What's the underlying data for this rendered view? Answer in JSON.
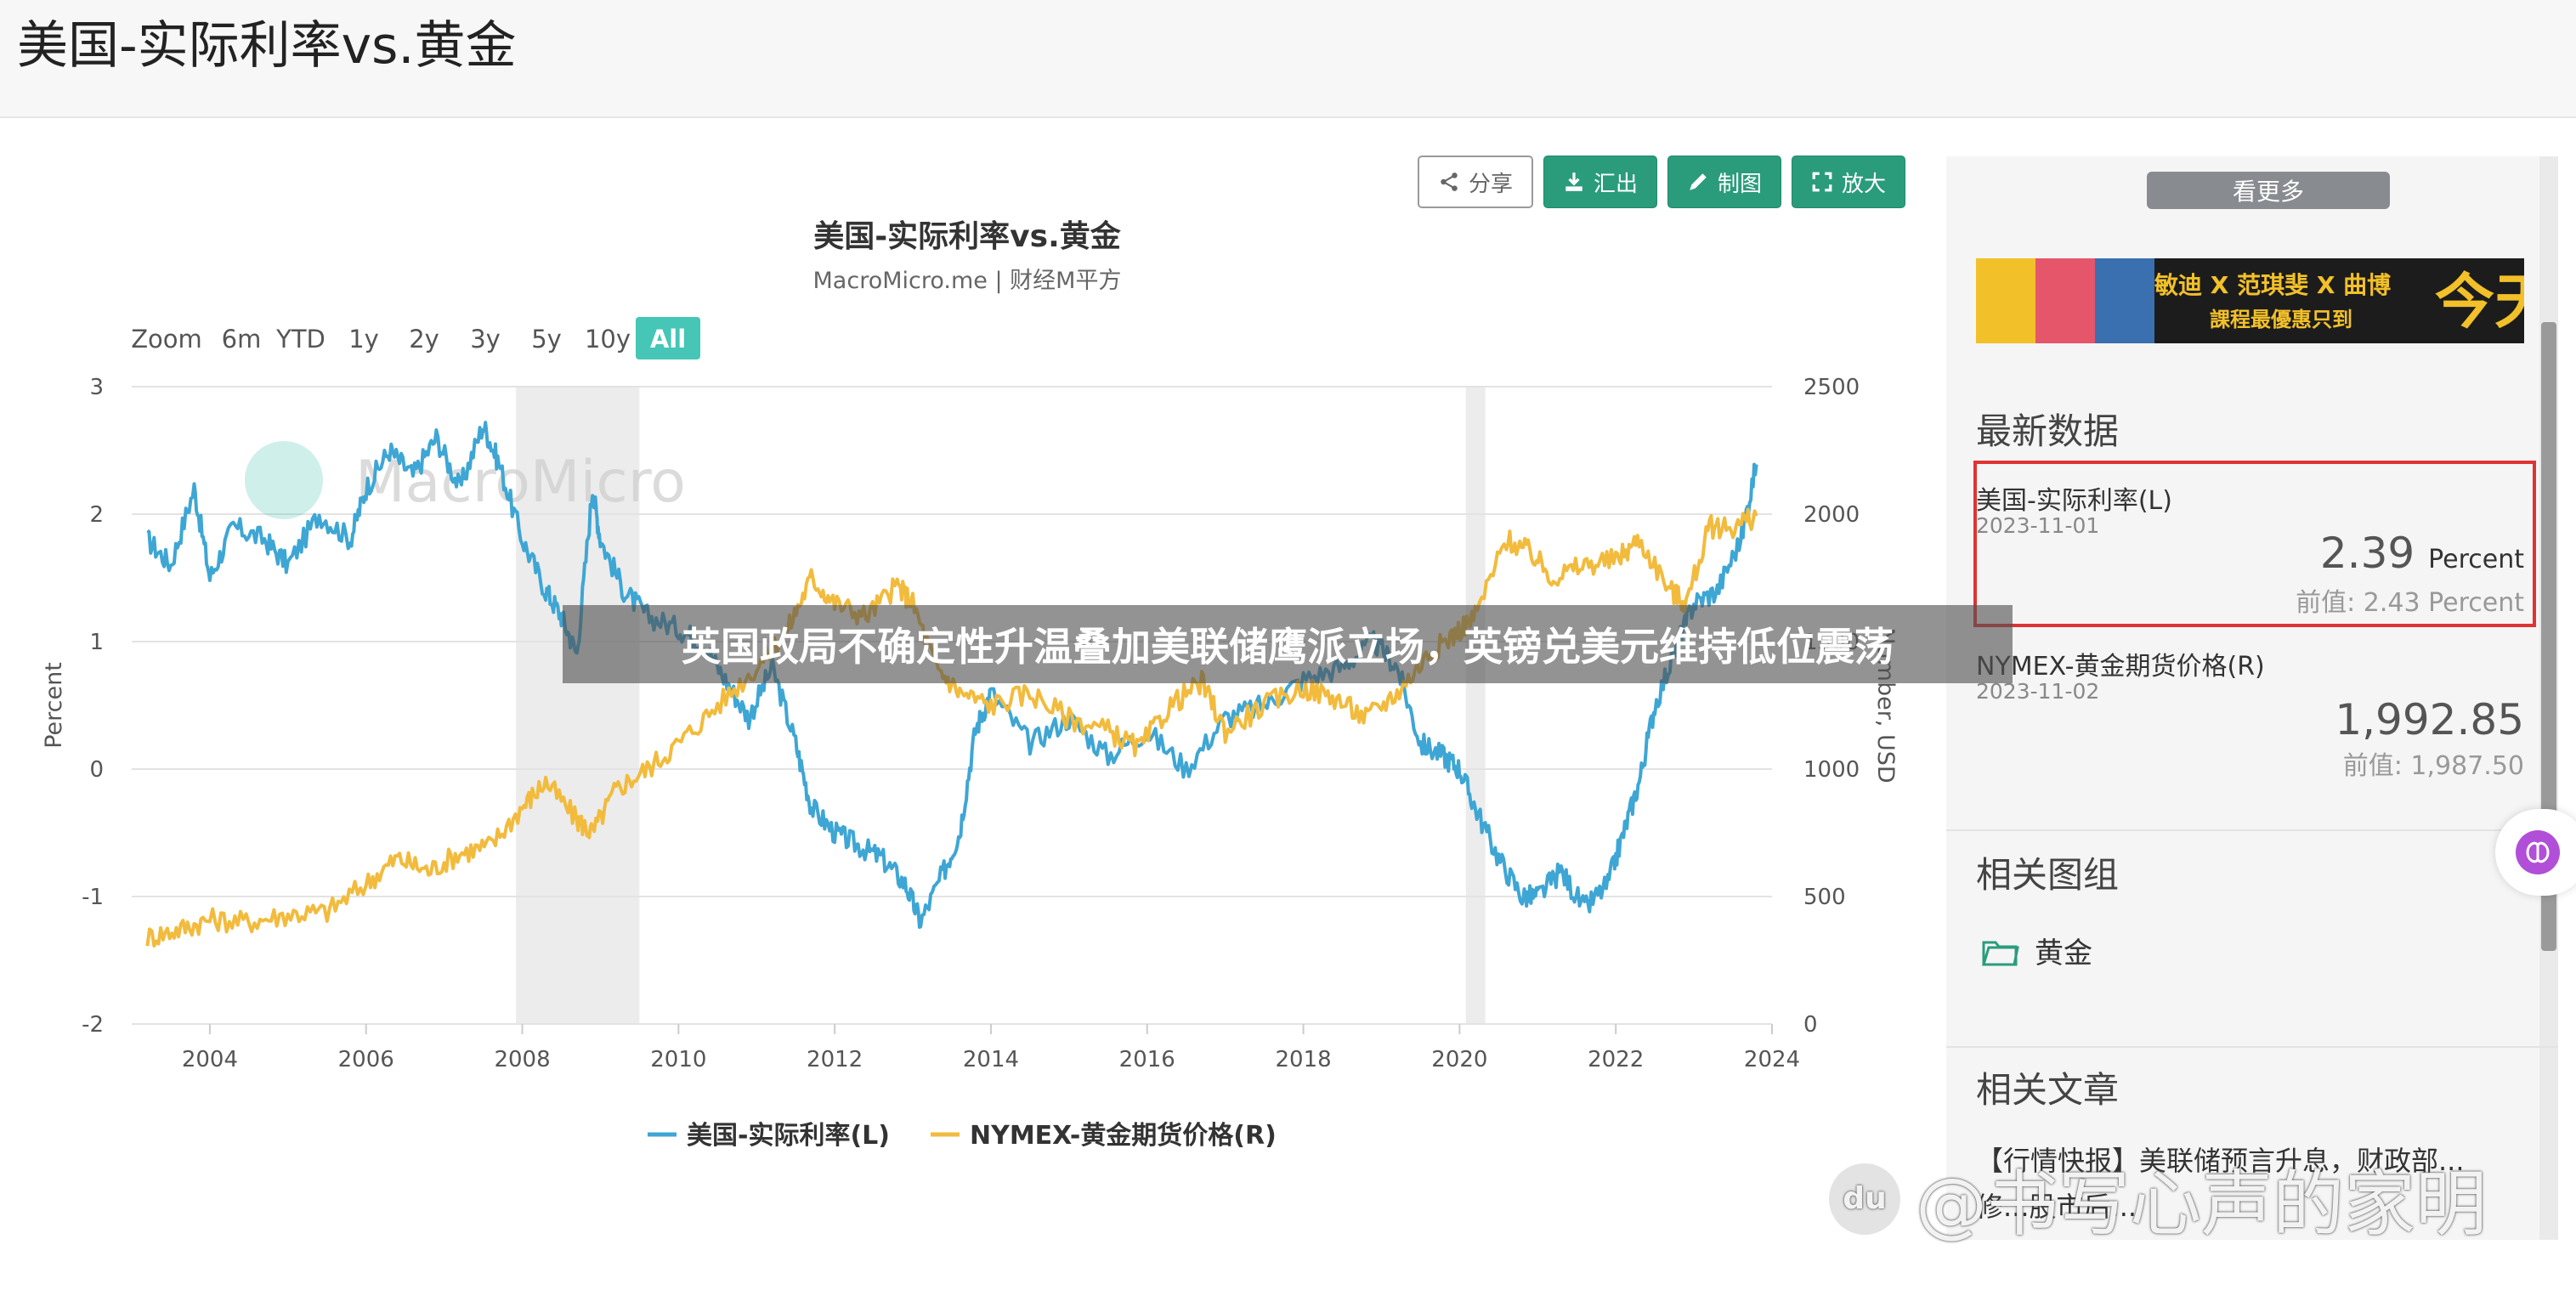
{
  "page": {
    "title": "美国-实际利率vs.黄金"
  },
  "toolbar": {
    "share": "分享",
    "export": "汇出",
    "draw": "制图",
    "zoom": "放大"
  },
  "chart_data": {
    "type": "line",
    "title": "美国-实际利率vs.黄金",
    "subtitle": "MacroMicro.me | 财经M平方",
    "watermark": "MacroMicro",
    "range_buttons": [
      "Zoom",
      "6m",
      "YTD",
      "1y",
      "2y",
      "3y",
      "5y",
      "10y",
      "All"
    ],
    "selected_range": "All",
    "xlim": [
      2003.0,
      2024.0
    ],
    "x_ticks": [
      "2004",
      "2006",
      "2008",
      "2010",
      "2012",
      "2014",
      "2016",
      "2018",
      "2020",
      "2022",
      "2024"
    ],
    "y_left": {
      "label": "Percent",
      "lim": [
        -2,
        3
      ],
      "ticks": [
        "3",
        "2",
        "1",
        "0",
        "-1",
        "-2"
      ]
    },
    "y_right": {
      "label": "Number, USD",
      "lim": [
        0,
        2500
      ],
      "ticks": [
        "2500",
        "2000",
        "1500",
        "1000",
        "500",
        "0"
      ]
    },
    "recession_bands": [
      [
        2007.92,
        2009.5
      ],
      [
        2020.08,
        2020.33
      ]
    ],
    "grid": true,
    "legend_position": "bottom",
    "colors": {
      "real_rate": "#3ea6d4",
      "gold": "#f2bb3d",
      "recession": "#ececec"
    },
    "series": [
      {
        "name": "美国-实际利率(L)",
        "axis": "left",
        "x": [
          2003.2,
          2003.5,
          2003.8,
          2004.0,
          2004.3,
          2004.7,
          2005.0,
          2005.4,
          2005.8,
          2006.0,
          2006.3,
          2006.6,
          2006.9,
          2007.2,
          2007.5,
          2007.7,
          2008.0,
          2008.3,
          2008.5,
          2008.7,
          2008.9,
          2009.0,
          2009.3,
          2009.6,
          2010.0,
          2010.3,
          2010.6,
          2010.9,
          2011.2,
          2011.5,
          2011.7,
          2012.0,
          2012.3,
          2012.6,
          2012.9,
          2013.1,
          2013.4,
          2013.6,
          2013.8,
          2014.0,
          2014.5,
          2015.0,
          2015.5,
          2016.0,
          2016.5,
          2017.0,
          2017.5,
          2018.0,
          2018.5,
          2018.9,
          2019.2,
          2019.5,
          2019.8,
          2020.0,
          2020.2,
          2020.5,
          2020.8,
          2021.0,
          2021.3,
          2021.6,
          2021.9,
          2022.1,
          2022.3,
          2022.5,
          2022.8,
          2023.0,
          2023.3,
          2023.6,
          2023.8
        ],
        "y": [
          1.8,
          1.6,
          2.2,
          1.5,
          1.9,
          1.8,
          1.6,
          2.0,
          1.8,
          2.2,
          2.5,
          2.3,
          2.6,
          2.2,
          2.7,
          2.4,
          1.8,
          1.4,
          1.2,
          0.9,
          2.2,
          1.8,
          1.4,
          1.2,
          1.1,
          1.0,
          0.7,
          0.4,
          0.8,
          0.2,
          -0.3,
          -0.5,
          -0.6,
          -0.7,
          -0.9,
          -1.2,
          -0.8,
          -0.5,
          0.3,
          0.6,
          0.2,
          0.4,
          0.1,
          0.3,
          0.0,
          0.4,
          0.5,
          0.7,
          0.8,
          1.0,
          0.8,
          0.2,
          0.1,
          0.0,
          -0.3,
          -0.7,
          -1.0,
          -1.0,
          -0.8,
          -1.1,
          -0.9,
          -0.5,
          -0.1,
          0.5,
          1.0,
          1.3,
          1.4,
          1.8,
          2.39
        ]
      },
      {
        "name": "NYMEX-黄金期货价格(R)",
        "axis": "right",
        "x": [
          2003.2,
          2003.6,
          2004.0,
          2004.5,
          2005.0,
          2005.5,
          2006.0,
          2006.4,
          2006.8,
          2007.2,
          2007.6,
          2008.0,
          2008.3,
          2008.7,
          2008.9,
          2009.2,
          2009.6,
          2010.0,
          2010.5,
          2011.0,
          2011.4,
          2011.7,
          2012.0,
          2012.4,
          2012.8,
          2013.0,
          2013.3,
          2013.6,
          2014.0,
          2014.5,
          2015.0,
          2015.5,
          2015.9,
          2016.3,
          2016.7,
          2017.0,
          2017.5,
          2018.0,
          2018.4,
          2018.8,
          2019.2,
          2019.6,
          2019.9,
          2020.2,
          2020.6,
          2020.9,
          2021.2,
          2021.6,
          2022.0,
          2022.3,
          2022.7,
          2022.9,
          2023.2,
          2023.5,
          2023.8
        ],
        "y": [
          340,
          370,
          410,
          400,
          430,
          440,
          550,
          650,
          600,
          670,
          700,
          850,
          950,
          800,
          750,
          920,
          1000,
          1100,
          1250,
          1400,
          1550,
          1750,
          1650,
          1600,
          1720,
          1650,
          1400,
          1300,
          1250,
          1300,
          1200,
          1150,
          1080,
          1250,
          1340,
          1150,
          1250,
          1320,
          1280,
          1200,
          1300,
          1450,
          1520,
          1600,
          1900,
          1850,
          1750,
          1800,
          1820,
          1900,
          1700,
          1650,
          1950,
          1950,
          1992.85
        ]
      }
    ]
  },
  "sidebar": {
    "see_more": "看更多",
    "banner": {
      "line1": "敏迪 X 范琪斐 X 曲博",
      "line2": "課程最優惠只到",
      "highlight": "今天"
    },
    "latest_title": "最新数据",
    "datasets": [
      {
        "name": "美国-实际利率(L)",
        "date": "2023-11-01",
        "value": "2.39",
        "unit": "Percent",
        "prev_label": "前值:",
        "prev": "2.43 Percent"
      },
      {
        "name": "NYMEX-黄金期货价格(R)",
        "date": "2023-11-02",
        "value": "1,992.85",
        "prev_label": "前值:",
        "prev": "1,987.50"
      }
    ],
    "groups_title": "相关图组",
    "group_item": "黄金",
    "articles_title": "相关文章",
    "article_snippet": "【行情快报】美联储预言升息，财政部...修...股市后..."
  },
  "overlay_caption": "英国政局不确定性升温叠加美联储鹰派立场，英镑兑美元维持低位震荡",
  "source_watermark": {
    "logo": "du",
    "text": "@书写心声的家明"
  }
}
